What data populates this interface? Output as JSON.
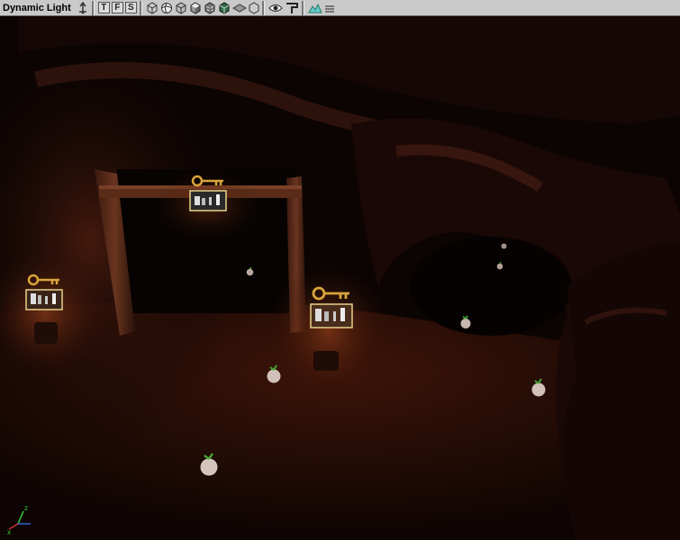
{
  "window": {
    "title": "Dynamic Light"
  },
  "toolbar": {
    "text_buttons": [
      "T",
      "F",
      "S"
    ],
    "icons": [
      "move-icon",
      "texture-icon",
      "face-icon",
      "show-icon",
      "cube-wire-icon",
      "sphere-icon",
      "cube-solid-icon",
      "cube-lit-icon",
      "cube-textured-icon",
      "cube-dark-icon",
      "cube-grey-icon",
      "eye-icon",
      "actor-flag-icon",
      "terrain-icon",
      "menu-icon"
    ]
  },
  "viewport": {
    "actors": [
      {
        "type": "key-with-light",
        "id": "key-light-center-top"
      },
      {
        "type": "key-with-light",
        "id": "key-light-left"
      },
      {
        "type": "key-with-light",
        "id": "key-light-center"
      },
      {
        "type": "pickup-apple",
        "id": "apple-1"
      },
      {
        "type": "pickup-apple",
        "id": "apple-2"
      },
      {
        "type": "pickup-apple",
        "id": "apple-3"
      },
      {
        "type": "pickup-apple",
        "id": "apple-4"
      },
      {
        "type": "pickup-apple",
        "id": "apple-5"
      },
      {
        "type": "pickup-apple",
        "id": "apple-6"
      },
      {
        "type": "pickup-apple",
        "id": "apple-7"
      },
      {
        "type": "pickup-apple",
        "id": "apple-8"
      }
    ],
    "axes_labels": {
      "z": "z",
      "x": "x"
    }
  },
  "colors": {
    "toolbar_bg": "#c9c9c9",
    "cave_dark": "#1a0a06",
    "cave_lit": "#5a2816",
    "key_gold": "#d9a43a",
    "selection_outline": "#e8d28a"
  }
}
